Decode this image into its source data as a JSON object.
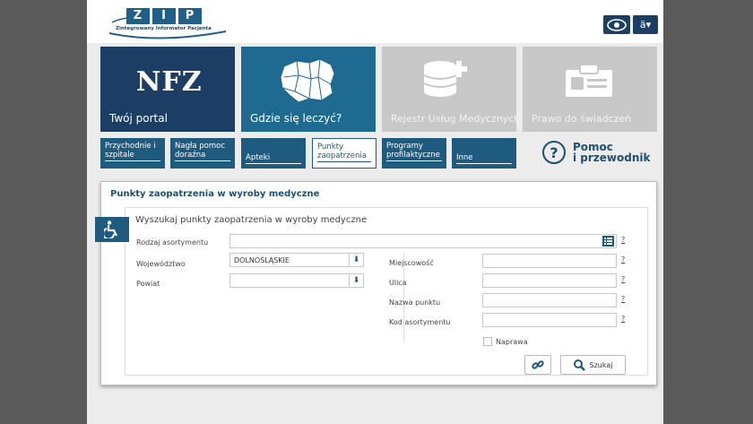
{
  "logo": {
    "letters": [
      "Z",
      "I",
      "P"
    ],
    "subtitle": "Zintegrowany Informator Pacjenta"
  },
  "accessibility": {
    "contrast_icon": "eye-icon",
    "font_icon": "font-size-icon"
  },
  "tiles": [
    {
      "label": "Twój portal",
      "logo_text": "NFZ",
      "color": "#1c3e64"
    },
    {
      "label": "Gdzie się leczyć?",
      "icon": "poland-map-icon",
      "color": "#1e6a90"
    },
    {
      "label": "Rejestr Usług Medycznych",
      "icon": "database-plus-icon",
      "color": "#c8c8c8"
    },
    {
      "label": "Prawo do świadczeń",
      "icon": "id-card-icon",
      "color": "#c8c8c8"
    }
  ],
  "subtabs": [
    {
      "label": "Przychodnie i szpitale"
    },
    {
      "label": "Nagła pomoc doraźna"
    },
    {
      "label": "Apteki"
    },
    {
      "label": "Punkty zaopatrzenia"
    },
    {
      "label": "Programy profilaktyczne"
    },
    {
      "label": "Inne"
    }
  ],
  "help": {
    "label_line1": "Pomoc",
    "label_line2": "i przewodnik"
  },
  "panel": {
    "title": "Punkty zaopatrzenia w wyroby medyczne",
    "search_title": "Wyszukaj punkty zaopatrzenia w wyroby medyczne",
    "fields": {
      "assortment_label": "Rodzaj asortymentu",
      "voivodeship_label": "Województwo",
      "voivodeship_value": "DOLNOŚLĄSKIE",
      "county_label": "Powiat",
      "county_value": "",
      "city_label": "Miejscowość",
      "street_label": "Ulica",
      "point_name_label": "Nazwa punktu",
      "code_label": "Kod asortymentu",
      "repair_label": "Naprawa"
    },
    "help_mark": "?",
    "search_button": "Szukaj"
  }
}
